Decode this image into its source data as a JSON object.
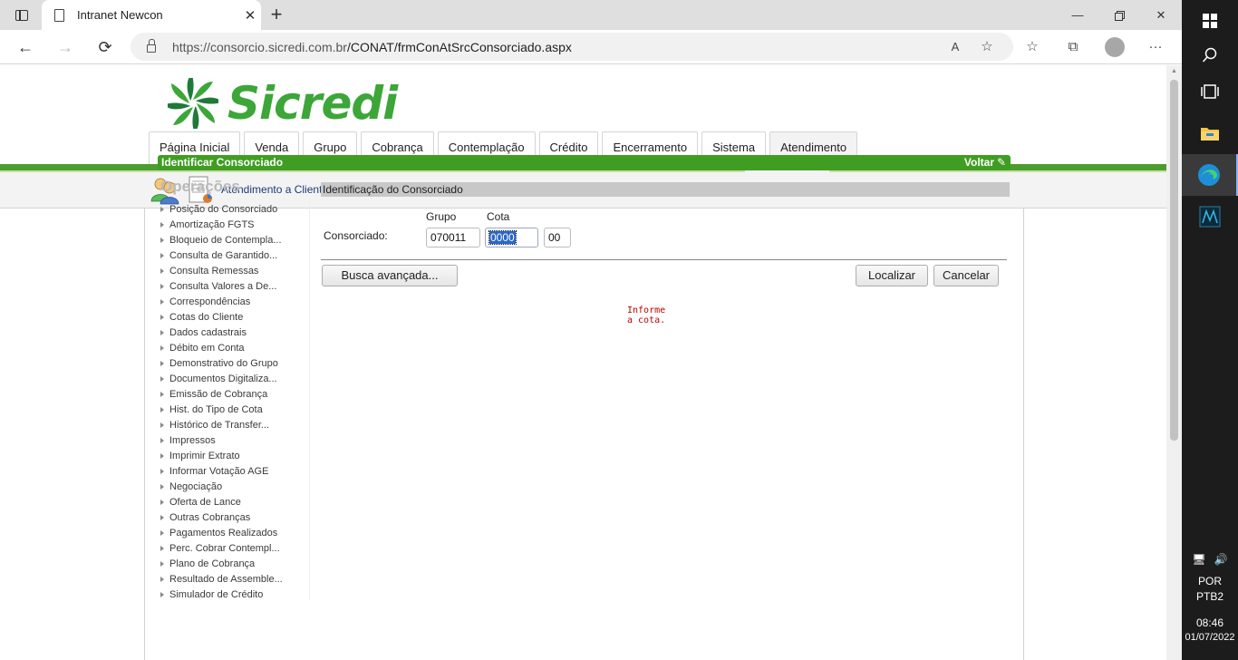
{
  "browser": {
    "tab_title": "Intranet Newcon",
    "url_host": "https://consorcio.sicredi.com.br",
    "url_path": "/CONAT/frmConAtSrcConsorciado.aspx",
    "read_aloud_glyph": "A",
    "minimize": "—",
    "close": "✕"
  },
  "site": {
    "logo_text": "Sicredi",
    "brand_color": "#3ca638"
  },
  "menu": {
    "tabs": [
      "Página Inicial",
      "Venda",
      "Grupo",
      "Cobrança",
      "Contemplação",
      "Crédito",
      "Encerramento",
      "Sistema",
      "Atendimento"
    ],
    "active": "Atendimento"
  },
  "subheader": {
    "link": "Atendimento a Clientes"
  },
  "section": {
    "title": "Identificar Consorciado",
    "back_link": "Voltar"
  },
  "operations": {
    "title": "Operações",
    "items": [
      "Posição do Consorciado",
      "Amortização FGTS",
      "Bloqueio de Contempla...",
      "Consulta de Garantido...",
      "Consulta Remessas",
      "Consulta Valores a De...",
      "Correspondências",
      "Cotas do Cliente",
      "Dados cadastrais",
      "Débito em Conta",
      "Demonstrativo do Grupo",
      "Documentos Digitaliza...",
      "Emissão de Cobrança",
      "Hist. do Tipo de Cota",
      "Histórico de Transfer...",
      "Impressos",
      "Imprimir Extrato",
      "Informar Votação AGE",
      "Negociação",
      "Oferta de Lance",
      "Outras Cobranças",
      "Pagamentos Realizados",
      "Perc. Cobrar Contempl...",
      "Plano de Cobrança",
      "Resultado de Assemble...",
      "Simulador de Crédito"
    ]
  },
  "form": {
    "header": "Identificação do Consorciado",
    "label_consorciado": "Consorciado:",
    "label_grupo": "Grupo",
    "label_cota": "Cota",
    "grupo_value": "070011",
    "cota_value": "0000",
    "digito_value": "00",
    "btn_busca": "Busca avançada...",
    "btn_localizar": "Localizar",
    "btn_cancelar": "Cancelar",
    "message": "Informe a cota."
  },
  "taskbar": {
    "lang1": "POR",
    "lang2": "PTB2",
    "time": "08:46",
    "date": "01/07/2022"
  }
}
